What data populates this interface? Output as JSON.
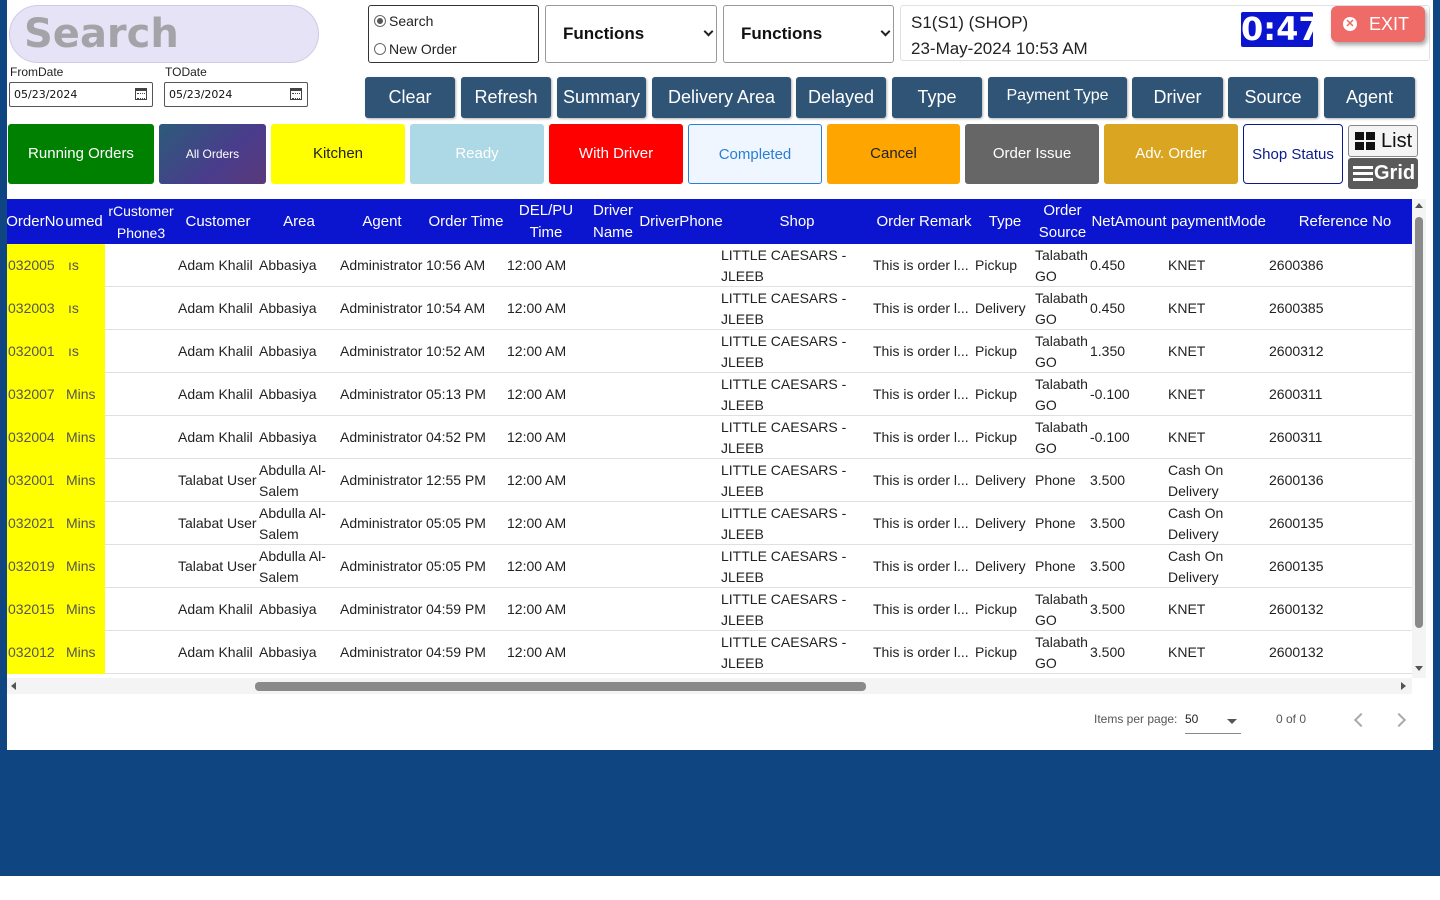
{
  "search": {
    "placeholder": "Search"
  },
  "dates": {
    "from_label": "FromDate",
    "from_value": "05/23/2024",
    "to_label": "TODate",
    "to_value": "05/23/2024"
  },
  "mode": {
    "options": [
      "Search",
      "New Order"
    ],
    "selected": "Search"
  },
  "selects": [
    "Functions",
    "Functions"
  ],
  "shop": {
    "name": "S1(S1) (SHOP)",
    "datetime": "23-May-2024 10:53 AM"
  },
  "timer": "0:47",
  "exit_label": "EXIT",
  "toolbar": [
    "Clear",
    "Refresh",
    "Summary",
    "Delivery Area",
    "Delayed",
    "Type",
    "Payment Type",
    "Driver",
    "Source",
    "Agent"
  ],
  "status_buttons": [
    {
      "label": "Running Orders",
      "color": "#008000"
    },
    {
      "label": "All Orders",
      "color": "#3a4c8a"
    },
    {
      "label": "Kitchen",
      "color": "#ffff00"
    },
    {
      "label": "Ready",
      "color": "#add8e6"
    },
    {
      "label": "With Driver",
      "color": "#ff0000"
    },
    {
      "label": "Completed",
      "color": "#f0f6ff"
    },
    {
      "label": "Cancel",
      "color": "#ffa500"
    },
    {
      "label": "Order Issue",
      "color": "#666666"
    },
    {
      "label": "Adv. Order",
      "color": "#daa520"
    },
    {
      "label": "Shop Status",
      "color": "#ffffff"
    }
  ],
  "view": {
    "list_label": "List",
    "grid_label": "Grid"
  },
  "table": {
    "header_color": "#0b14cf",
    "headers": [
      "OrderNo",
      "umed",
      "rCustomer Phone3",
      "Customer",
      "Area",
      "Agent",
      "Order Time",
      "DEL/PU Time",
      "Driver Name",
      "DriverPhone",
      "Shop",
      "Order Remark",
      "Type",
      "Order Source",
      "NetAmount",
      "paymentMode",
      "Reference No"
    ],
    "rows": [
      [
        "032005",
        "ıs",
        "",
        "Adam Khalil",
        "Abbasiya",
        "Administrator",
        "10:56 AM",
        "12:00 AM",
        "",
        "",
        "LITTLE CAESARS - JLEEB",
        "This is order l...",
        "Pickup",
        "Talabath GO",
        "0.450",
        "KNET",
        "2600386"
      ],
      [
        "032003",
        "ıs",
        "",
        "Adam Khalil",
        "Abbasiya",
        "Administrator",
        "10:54 AM",
        "12:00 AM",
        "",
        "",
        "LITTLE CAESARS - JLEEB",
        "This is order l...",
        "Delivery",
        "Talabath GO",
        "0.450",
        "KNET",
        "2600385"
      ],
      [
        "032001",
        "ıs",
        "",
        "Adam Khalil",
        "Abbasiya",
        "Administrator",
        "10:52 AM",
        "12:00 AM",
        "",
        "",
        "LITTLE CAESARS - JLEEB",
        "This is order l...",
        "Pickup",
        "Talabath GO",
        "1.350",
        "KNET",
        "2600312"
      ],
      [
        "032007",
        "Mins",
        "",
        "Adam Khalil",
        "Abbasiya",
        "Administrator",
        "05:13 PM",
        "12:00 AM",
        "",
        "",
        "LITTLE CAESARS - JLEEB",
        "This is order l...",
        "Pickup",
        "Talabath GO",
        "-0.100",
        "KNET",
        "2600311"
      ],
      [
        "032004",
        "Mins",
        "",
        "Adam Khalil",
        "Abbasiya",
        "Administrator",
        "04:52 PM",
        "12:00 AM",
        "",
        "",
        "LITTLE CAESARS - JLEEB",
        "This is order l...",
        "Pickup",
        "Talabath GO",
        "-0.100",
        "KNET",
        "2600311"
      ],
      [
        "032001",
        "Mins",
        "",
        "Talabat User",
        "Abdulla Al-Salem",
        "Administrator",
        "12:55 PM",
        "12:00 AM",
        "",
        "",
        "LITTLE CAESARS - JLEEB",
        "This is order l...",
        "Delivery",
        "Phone",
        "3.500",
        "Cash On Delivery",
        "2600136"
      ],
      [
        "032021",
        "Mins",
        "",
        "Talabat User",
        "Abdulla Al-Salem",
        "Administrator",
        "05:05 PM",
        "12:00 AM",
        "",
        "",
        "LITTLE CAESARS - JLEEB",
        "This is order l...",
        "Delivery",
        "Phone",
        "3.500",
        "Cash On Delivery",
        "2600135"
      ],
      [
        "032019",
        "Mins",
        "",
        "Talabat User",
        "Abdulla Al-Salem",
        "Administrator",
        "05:05 PM",
        "12:00 AM",
        "",
        "",
        "LITTLE CAESARS - JLEEB",
        "This is order l...",
        "Delivery",
        "Phone",
        "3.500",
        "Cash On Delivery",
        "2600135"
      ],
      [
        "032015",
        "Mins",
        "",
        "Adam Khalil",
        "Abbasiya",
        "Administrator",
        "04:59 PM",
        "12:00 AM",
        "",
        "",
        "LITTLE CAESARS - JLEEB",
        "This is order l...",
        "Pickup",
        "Talabath GO",
        "3.500",
        "KNET",
        "2600132"
      ],
      [
        "032012",
        "Mins",
        "",
        "Adam Khalil",
        "Abbasiya",
        "Administrator",
        "04:59 PM",
        "12:00 AM",
        "",
        "",
        "LITTLE CAESARS - JLEEB",
        "This is order l...",
        "Pickup",
        "Talabath GO",
        "3.500",
        "KNET",
        "2600132"
      ]
    ]
  },
  "paginator": {
    "items_label": "Items per page:",
    "page_size": "50",
    "range": "0 of 0"
  }
}
